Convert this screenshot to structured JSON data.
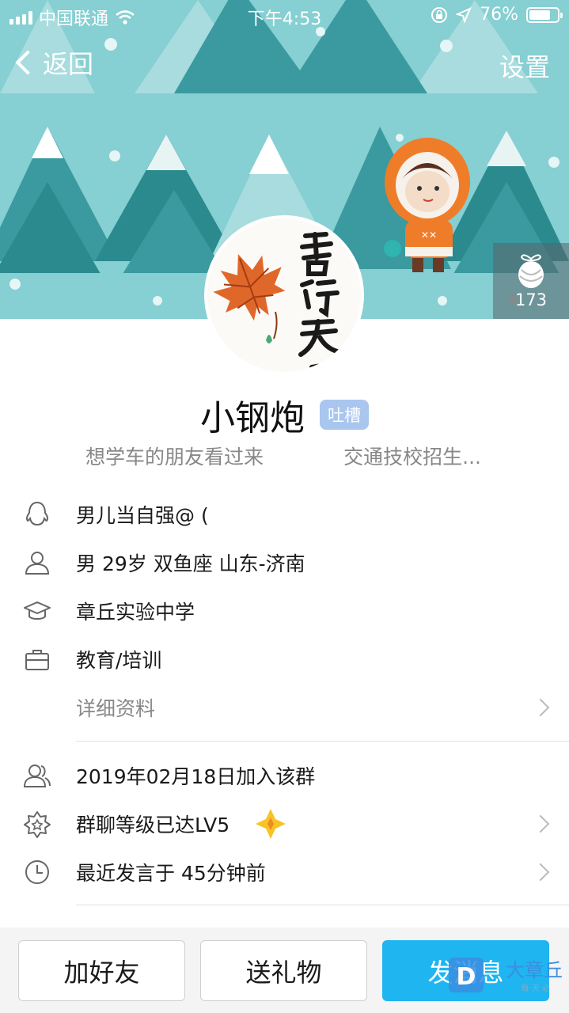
{
  "status_bar": {
    "carrier": "中国联通",
    "time": "下午4:53",
    "battery": "76%",
    "battery_level": 0.76
  },
  "nav": {
    "back_label": "返回",
    "settings_label": "设置"
  },
  "gifts": {
    "count": "173"
  },
  "avatar": {
    "calligraphy": "善行天下"
  },
  "profile": {
    "name": "小钢炮",
    "badge": "吐槽",
    "tagline_left": "想学车的朋友看过来",
    "tagline_right": "交通技校招生..."
  },
  "info": {
    "qq_nick": "男儿当自强@ (",
    "personal": "男  29岁  双鱼座  山东-济南",
    "school": "章丘实验中学",
    "work": "教育/培训",
    "details": "详细资料",
    "joined": "2019年02月18日加入该群",
    "level": "群聊等级已达LV5",
    "last_speak": "最近发言于 45分钟前"
  },
  "actions": {
    "add_friend": "加好友",
    "send_gift": "送礼物",
    "send_message": "发消息"
  },
  "watermark": {
    "text": "大章丘",
    "sub": "每 天 必"
  },
  "colors": {
    "banner_bg": "#86cfd2",
    "tree_dark": "#2a8a8e",
    "accent_blue": "#1fb5f1",
    "badge_bg": "#a9c6ef"
  }
}
